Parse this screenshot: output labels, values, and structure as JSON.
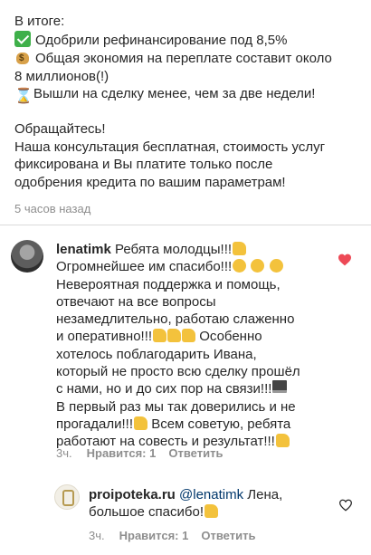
{
  "post": {
    "heading": "В итоге:",
    "items": [
      {
        "icon": "check-icon",
        "text": "Одобрили рефинансирование под 8,5%"
      },
      {
        "icon": "money-bag-icon",
        "text": "Общая экономия на переплате составит около\n8 миллионов(!)"
      },
      {
        "icon": "hourglass-icon",
        "text": "Вышли на сделку менее, чем за две недели!"
      }
    ],
    "cta_title": "Обращайтесь!",
    "cta_text": "Наша консультация бесплатная, стоимость услуг\nфиксирована и Вы платите только после\nодобрения кредита по вашим параметрам!",
    "time": "5 часов назад"
  },
  "comments": [
    {
      "username": "lenatimk",
      "text_parts": [
        "Ребята молодцы!!!",
        "\nОгромнейшее им спасибо!!!",
        "\nНевероятная поддержка и помощь,\nотвечают на все вопросы\nнезамедлительно, работаю слаженно\nи оперативно!!!",
        " Особенно\nхотелось поблагодарить Ивана,\nкоторый не просто всю сделку прошёл\nс нами, но и до сих пор на связи!!!",
        "\nВ первый раз мы так доверились и не\nпрогадали!!!",
        " Всем советую, ребята\nработают на совесть и результат!!!"
      ],
      "ago": "3ч.",
      "likes": "Нравится: 1",
      "reply": "Ответить"
    },
    {
      "username": "proipoteka.ru",
      "mention": "@lenatimk",
      "text": " Лена,\nбольшое спасибо!",
      "ago": "3ч.",
      "likes": "Нравится: 1",
      "reply": "Ответить"
    }
  ],
  "colors": {
    "heart_active": "#ed4956",
    "meta_text": "#8e8e8e",
    "mention": "#00376b"
  }
}
